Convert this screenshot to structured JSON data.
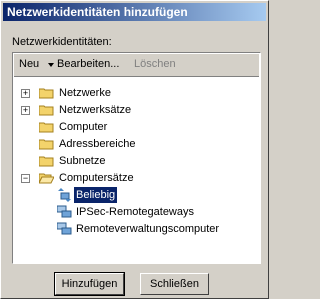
{
  "window": {
    "title": "Netzwerkidentitäten hinzufügen"
  },
  "section": {
    "label": "Netzwerkidentitäten:"
  },
  "toolbar": {
    "new_label": "Neu",
    "edit_label": "Bearbeiten...",
    "delete_label": "Löschen"
  },
  "tree": {
    "items": [
      {
        "label": "Netzwerke"
      },
      {
        "label": "Netzwerksätze"
      },
      {
        "label": "Computer"
      },
      {
        "label": "Adressbereiche"
      },
      {
        "label": "Subnetze"
      },
      {
        "label": "Computersätze"
      },
      {
        "label": "Beliebig"
      },
      {
        "label": "IPSec-Remotegateways"
      },
      {
        "label": "Remoteverwaltungscomputer"
      }
    ]
  },
  "buttons": {
    "add_label": "Hinzufügen",
    "close_label": "Schließen"
  },
  "colors": {
    "title_bar": "#0a246a",
    "selection": "#0a246a",
    "folder": "#f3d36b"
  }
}
